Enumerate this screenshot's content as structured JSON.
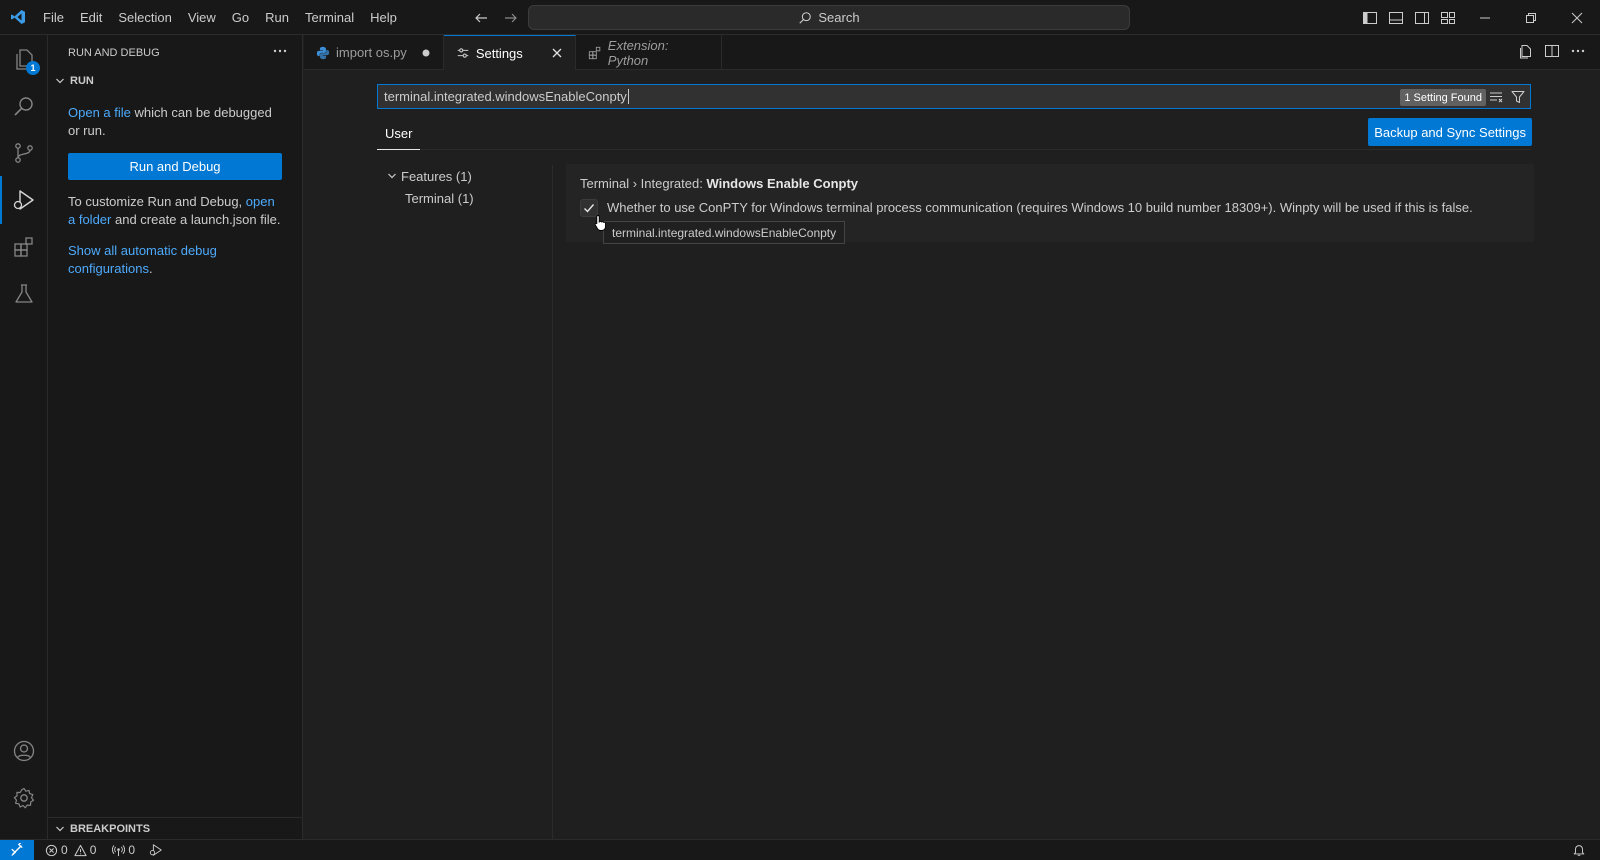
{
  "menubar": {
    "items": [
      "File",
      "Edit",
      "Selection",
      "View",
      "Go",
      "Run",
      "Terminal",
      "Help"
    ]
  },
  "command_center": {
    "label": "Search"
  },
  "activity_bar": {
    "explorer_badge": "1",
    "items": [
      "explorer-icon",
      "search-icon",
      "source-control-icon",
      "run-debug-icon",
      "extensions-icon",
      "testing-icon",
      "account-icon",
      "settings-gear-icon"
    ]
  },
  "sidebar": {
    "title": "RUN AND DEBUG",
    "run_section": "RUN",
    "open_file_link": "Open a file",
    "open_file_rest": " which can be debugged or run.",
    "run_button": "Run and Debug",
    "customize_prefix": "To customize Run and Debug, ",
    "open_folder_link": "open a folder",
    "customize_suffix": " and create a launch.json file.",
    "show_all_link": "Show all automatic debug configurations",
    "show_all_suffix": ".",
    "breakpoints_section": "BREAKPOINTS"
  },
  "tabs": [
    {
      "label": "import os.py",
      "state": "modified"
    },
    {
      "label": "Settings",
      "state": "active"
    },
    {
      "label": "Extension: Python",
      "state": "preview"
    }
  ],
  "settings": {
    "search_value": "terminal.integrated.windowsEnableConpty",
    "found_badge": "1 Setting Found",
    "scope_tab": "User",
    "sync_button": "Backup and Sync Settings",
    "toc": [
      {
        "label": "Features (1)"
      },
      {
        "label": "Terminal (1)"
      }
    ],
    "item": {
      "category": "Terminal › Integrated: ",
      "name": "Windows Enable Conpty",
      "checked": true,
      "description": "Whether to use ConPTY for Windows terminal process communication (requires Windows 10 build number 18309+). Winpty will be used if this is false.",
      "tooltip": "terminal.integrated.windowsEnableConpty"
    }
  },
  "statusbar": {
    "errors": "0",
    "warnings": "0",
    "ports": "0"
  },
  "colors": {
    "accent": "#0078d4",
    "link": "#4daafc",
    "background": "#1f1f1f",
    "chrome": "#181818"
  }
}
